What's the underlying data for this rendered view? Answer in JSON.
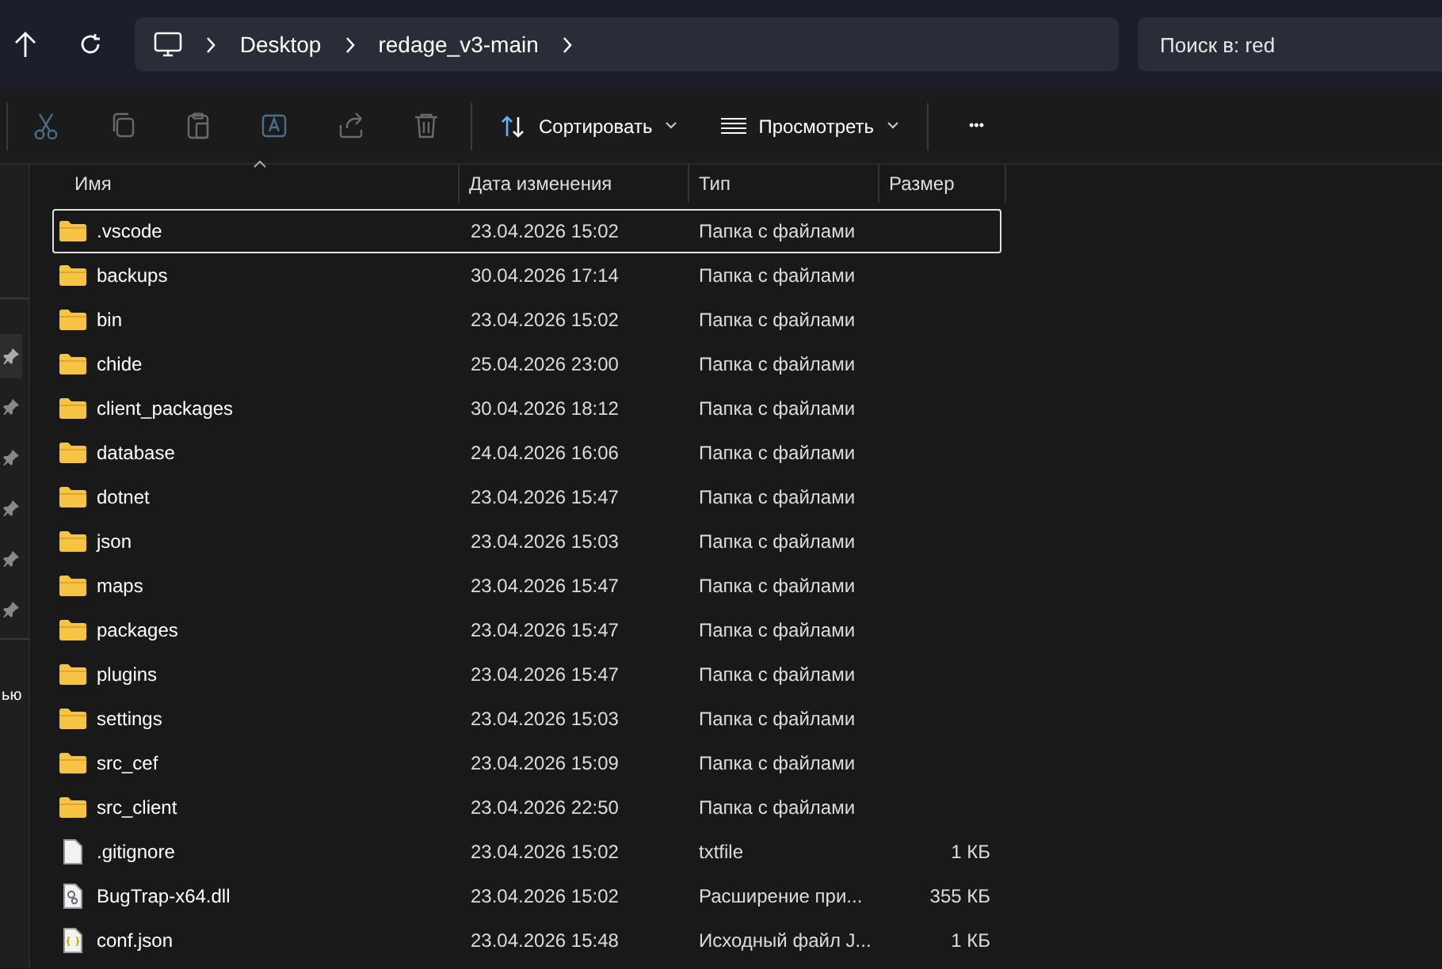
{
  "address_bar": {
    "crumbs": [
      "Desktop",
      "redage_v3-main"
    ],
    "search_placeholder": "Поиск в: red"
  },
  "toolbar": {
    "actions": [
      {
        "kind": "cut",
        "disabled": true
      },
      {
        "kind": "copy",
        "disabled": true
      },
      {
        "kind": "paste",
        "disabled": true
      },
      {
        "kind": "rename",
        "disabled": true
      },
      {
        "kind": "share",
        "disabled": true
      },
      {
        "kind": "delete",
        "disabled": true
      }
    ],
    "sort_label": "Сортировать",
    "view_label": "Просмотреть",
    "more_label": "•••"
  },
  "sidebar": {
    "pins": [
      {
        "selected": true
      },
      {
        "selected": false
      },
      {
        "selected": false
      },
      {
        "selected": false
      },
      {
        "selected": false
      },
      {
        "selected": false
      }
    ],
    "partial_text": "ью"
  },
  "table": {
    "columns": [
      "Имя",
      "Дата изменения",
      "Тип",
      "Размер"
    ],
    "rows": [
      {
        "kind": "folder",
        "name": ".vscode",
        "date": "23.04.2026 15:02",
        "type": "Папка с файлами",
        "size": "",
        "focused": true
      },
      {
        "kind": "folder",
        "name": "backups",
        "date": "30.04.2026 17:14",
        "type": "Папка с файлами",
        "size": "",
        "focused": false
      },
      {
        "kind": "folder",
        "name": "bin",
        "date": "23.04.2026 15:02",
        "type": "Папка с файлами",
        "size": "",
        "focused": false
      },
      {
        "kind": "folder",
        "name": "chide",
        "date": "25.04.2026 23:00",
        "type": "Папка с файлами",
        "size": "",
        "focused": false
      },
      {
        "kind": "folder",
        "name": "client_packages",
        "date": "30.04.2026 18:12",
        "type": "Папка с файлами",
        "size": "",
        "focused": false
      },
      {
        "kind": "folder",
        "name": "database",
        "date": "24.04.2026 16:06",
        "type": "Папка с файлами",
        "size": "",
        "focused": false
      },
      {
        "kind": "folder",
        "name": "dotnet",
        "date": "23.04.2026 15:47",
        "type": "Папка с файлами",
        "size": "",
        "focused": false
      },
      {
        "kind": "folder",
        "name": "json",
        "date": "23.04.2026 15:03",
        "type": "Папка с файлами",
        "size": "",
        "focused": false
      },
      {
        "kind": "folder",
        "name": "maps",
        "date": "23.04.2026 15:47",
        "type": "Папка с файлами",
        "size": "",
        "focused": false
      },
      {
        "kind": "folder",
        "name": "packages",
        "date": "23.04.2026 15:47",
        "type": "Папка с файлами",
        "size": "",
        "focused": false
      },
      {
        "kind": "folder",
        "name": "plugins",
        "date": "23.04.2026 15:47",
        "type": "Папка с файлами",
        "size": "",
        "focused": false
      },
      {
        "kind": "folder",
        "name": "settings",
        "date": "23.04.2026 15:03",
        "type": "Папка с файлами",
        "size": "",
        "focused": false
      },
      {
        "kind": "folder",
        "name": "src_cef",
        "date": "23.04.2026 15:09",
        "type": "Папка с файлами",
        "size": "",
        "focused": false
      },
      {
        "kind": "folder",
        "name": "src_client",
        "date": "23.04.2026 22:50",
        "type": "Папка с файлами",
        "size": "",
        "focused": false
      },
      {
        "kind": "text",
        "name": ".gitignore",
        "date": "23.04.2026 15:02",
        "type": "txtfile",
        "size": "1 КБ",
        "focused": false
      },
      {
        "kind": "dll",
        "name": "BugTrap-x64.dll",
        "date": "23.04.2026 15:02",
        "type": "Расширение при...",
        "size": "355 КБ",
        "focused": false
      },
      {
        "kind": "json",
        "name": "conf.json",
        "date": "23.04.2026 15:48",
        "type": "Исходный файл J...",
        "size": "1 КБ",
        "focused": false
      }
    ]
  }
}
